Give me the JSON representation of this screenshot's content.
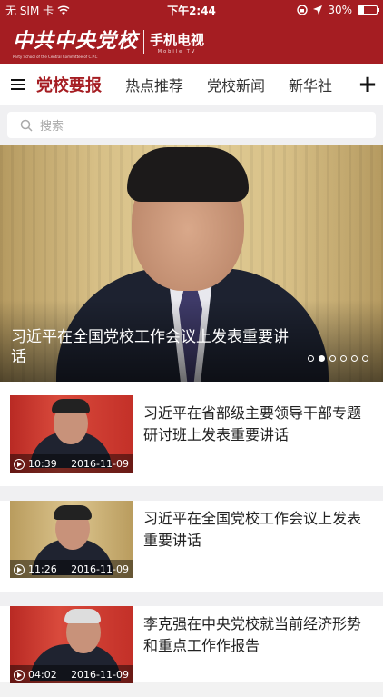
{
  "status_bar": {
    "carrier": "无 SIM 卡",
    "time": "下午2:44",
    "battery": "30%",
    "battery_level": 0.3
  },
  "header": {
    "logo_cn": "中共中央党校",
    "logo_en": "Party School of the Central Committee of C.P.C",
    "logo_tv": "手机电视",
    "logo_tv_en": "Mobile TV"
  },
  "tabs": [
    "党校要报",
    "热点推荐",
    "党校新闻",
    "新华社"
  ],
  "search": {
    "placeholder": "搜索"
  },
  "hero": {
    "title": "习近平在全国党校工作会议上发表重要讲话",
    "slide_count": 6,
    "active_slide": 1
  },
  "videos": [
    {
      "title": "习近平在省部级主要领导干部专题研讨班上发表重要讲话",
      "duration": "10:39",
      "date": "2016-11-09"
    },
    {
      "title": "习近平在全国党校工作会议上发表重要讲话",
      "duration": "11:26",
      "date": "2016-11-09"
    },
    {
      "title": "李克强在中央党校就当前经济形势和重点工作作报告",
      "duration": "04:02",
      "date": "2016-11-09"
    }
  ]
}
